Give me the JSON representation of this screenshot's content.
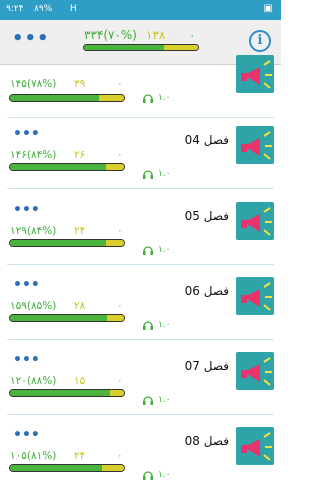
{
  "status_bar": {
    "time": "۹:۲۴",
    "battery": "۸۹%",
    "signal": "H"
  },
  "header": {
    "total": "۳۳۴(۷۰%)",
    "count": "۱۳۸",
    "zero": "۰",
    "progress": 0.7
  },
  "cards": [
    {
      "chapter": "",
      "total": "۱۴۵(۷۸%)",
      "count": "۳۹",
      "zero": "۰",
      "listen": "۱.۰",
      "progress": 0.78
    },
    {
      "chapter": "فصل 04",
      "total": "۱۴۶(۸۴%)",
      "count": "۲۶",
      "zero": "۰",
      "listen": "۱.۰",
      "progress": 0.84
    },
    {
      "chapter": "فصل 05",
      "total": "۱۲۹(۸۴%)",
      "count": "۲۴",
      "zero": "۰",
      "listen": "۱.۰",
      "progress": 0.84
    },
    {
      "chapter": "فصل 06",
      "total": "۱۵۹(۸۵%)",
      "count": "۲۸",
      "zero": "۰",
      "listen": "۱.۰",
      "progress": 0.85
    },
    {
      "chapter": "فصل 07",
      "total": "۱۲۰(۸۸%)",
      "count": "۱۵",
      "zero": "۰",
      "listen": "۱.۰",
      "progress": 0.88
    },
    {
      "chapter": "فصل 08",
      "total": "۱۰۵(۸۱%)",
      "count": "۲۴",
      "zero": "۰",
      "listen": "۱.۰",
      "progress": 0.81
    }
  ]
}
